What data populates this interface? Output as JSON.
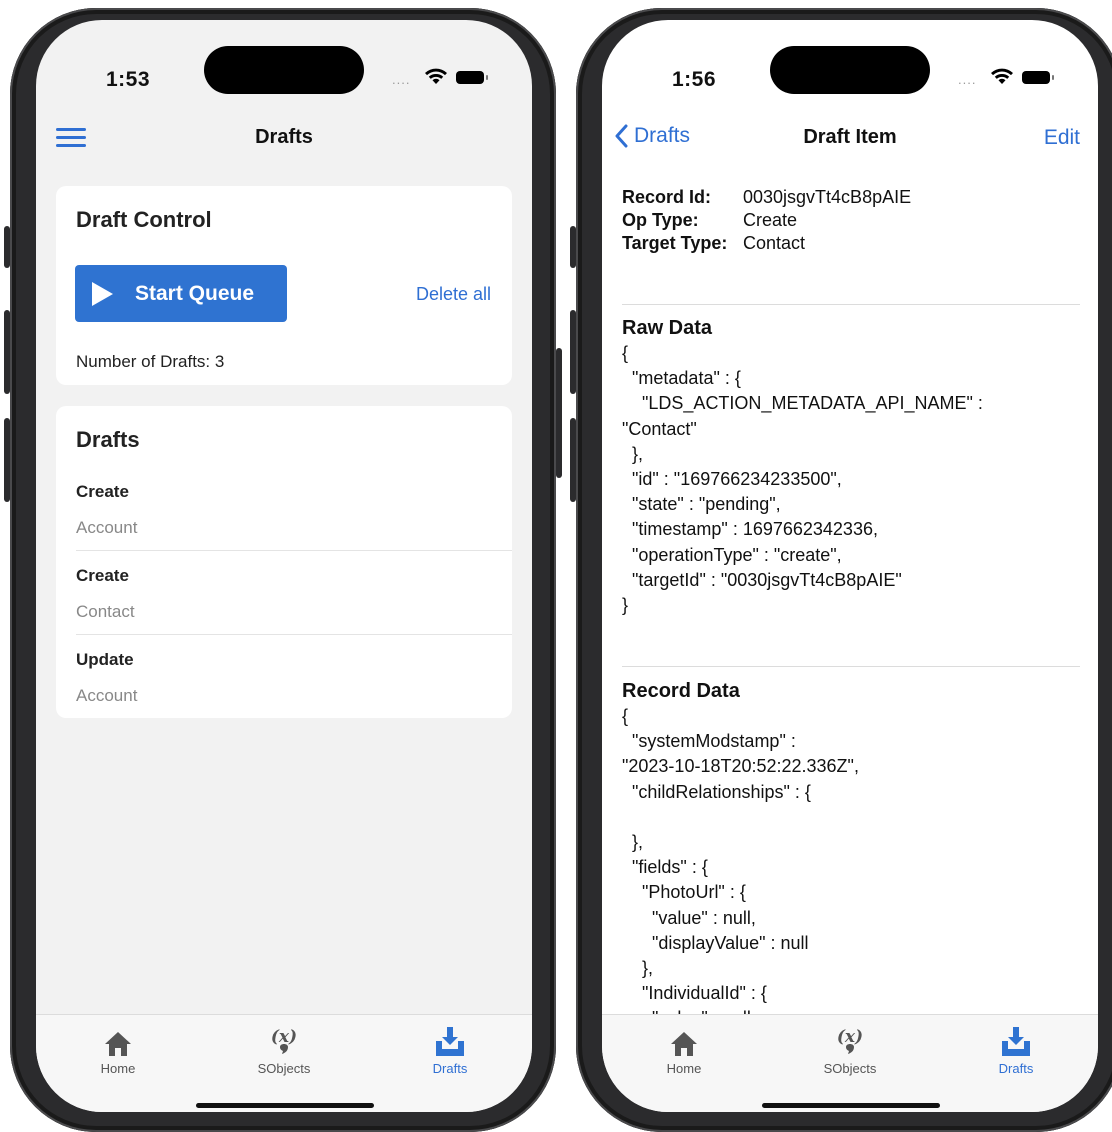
{
  "left": {
    "status": {
      "time": "1:53"
    },
    "nav_title": "Drafts",
    "control": {
      "title": "Draft Control",
      "start_label": "Start Queue",
      "delete_label": "Delete all",
      "count_text": "Number of Drafts: 3"
    },
    "drafts": {
      "title": "Drafts",
      "items": [
        {
          "op": "Create",
          "target": "Account"
        },
        {
          "op": "Create",
          "target": "Contact"
        },
        {
          "op": "Update",
          "target": "Account"
        }
      ]
    }
  },
  "right": {
    "status": {
      "time": "1:56"
    },
    "back_label": "Drafts",
    "nav_title": "Draft Item",
    "edit_label": "Edit",
    "info": {
      "record_id_label": "Record Id:",
      "record_id": "0030jsgvTt4cB8pAIE",
      "op_type_label": "Op Type:",
      "op_type": "Create",
      "target_type_label": "Target Type:",
      "target_type": "Contact"
    },
    "raw_data": {
      "title": "Raw Data",
      "text": "{\n  \"metadata\" : {\n    \"LDS_ACTION_METADATA_API_NAME\" :\n\"Contact\"\n  },\n  \"id\" : \"169766234233500\",\n  \"state\" : \"pending\",\n  \"timestamp\" : 1697662342336,\n  \"operationType\" : \"create\",\n  \"targetId\" : \"0030jsgvTt4cB8pAIE\"\n}"
    },
    "record_data": {
      "title": "Record Data",
      "text": "{\n  \"systemModstamp\" :\n\"2023-10-18T20:52:22.336Z\",\n  \"childRelationships\" : {\n\n  },\n  \"fields\" : {\n    \"PhotoUrl\" : {\n      \"value\" : null,\n      \"displayValue\" : null\n    },\n    \"IndividualId\" : {\n      \"value\" : null,"
    }
  },
  "tabbar": {
    "home": "Home",
    "sobjects": "SObjects",
    "drafts": "Drafts",
    "active": "drafts"
  },
  "colors": {
    "accent": "#2f73d1"
  }
}
